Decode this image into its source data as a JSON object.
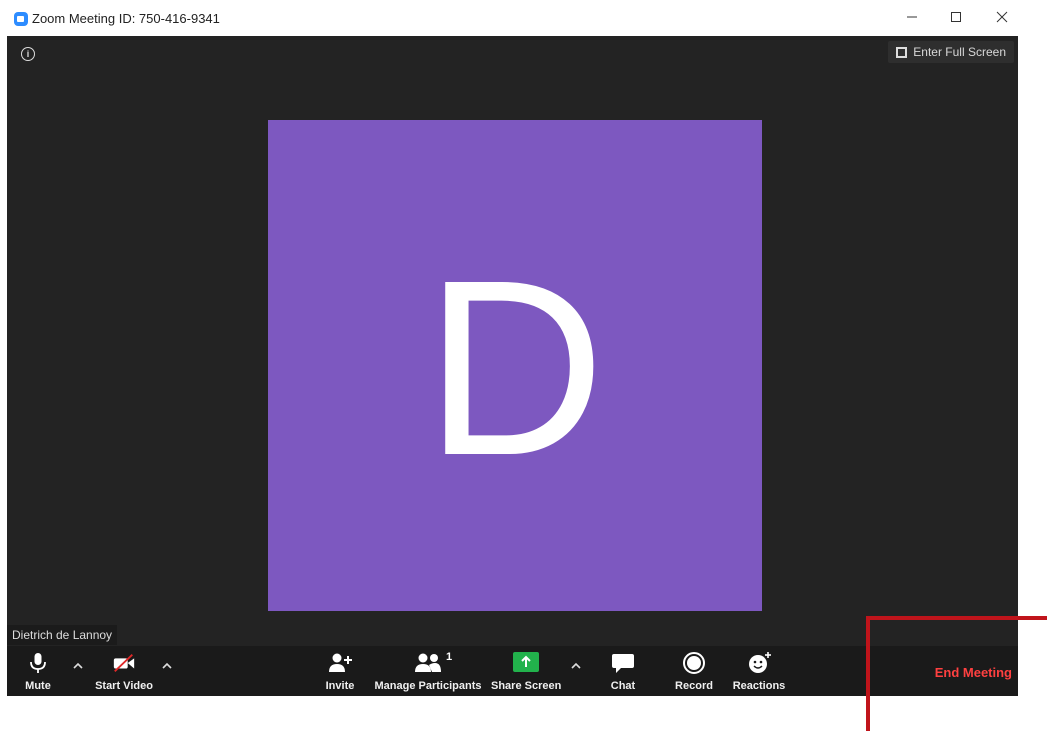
{
  "window": {
    "title": "Zoom Meeting ID: 750-416-9341",
    "controls": [
      "minimize",
      "maximize",
      "close"
    ]
  },
  "meeting": {
    "fullscreen_label": "Enter Full Screen",
    "avatar_letter": "D",
    "avatar_color": "#7d58c0",
    "participant_name": "Dietrich de Lannoy"
  },
  "toolbar": {
    "mute_label": "Mute",
    "start_video_label": "Start Video",
    "invite_label": "Invite",
    "manage_participants_label": "Manage Participants",
    "participant_count": "1",
    "share_screen_label": "Share Screen",
    "chat_label": "Chat",
    "record_label": "Record",
    "reactions_label": "Reactions",
    "end_meeting_label": "End Meeting",
    "end_meeting_color": "#ff4040",
    "share_color": "#22b24c"
  },
  "annotation": {
    "color": "#c0141b"
  }
}
